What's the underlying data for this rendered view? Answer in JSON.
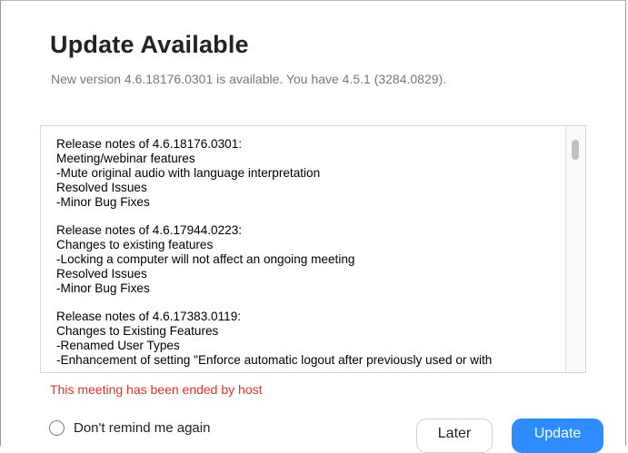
{
  "dialog": {
    "title": "Update Available",
    "subtitle": "New version 4.6.18176.0301 is available. You have 4.5.1 (3284.0829)."
  },
  "release_notes": {
    "blocks": [
      {
        "lines": [
          "Release notes of 4.6.18176.0301:",
          "Meeting/webinar features",
          "-Mute original audio with language interpretation",
          "Resolved Issues",
          "-Minor Bug Fixes"
        ]
      },
      {
        "lines": [
          "Release notes of 4.6.17944.0223:",
          "Changes to existing features",
          "-Locking a computer will not affect an ongoing meeting",
          "Resolved Issues",
          "-Minor Bug Fixes"
        ]
      },
      {
        "lines": [
          "Release notes of 4.6.17383.0119:",
          "Changes to Existing Features",
          "-Renamed User Types",
          "-Enhancement of setting \"Enforce automatic logout after previously used or with"
        ]
      }
    ]
  },
  "status": {
    "error_message": "This meeting has been ended by host",
    "error_color": "#e0332e"
  },
  "footer": {
    "remind_label": "Don't remind me again",
    "remind_checked": false,
    "later_label": "Later",
    "update_label": "Update",
    "accent_color": "#2d8cff"
  }
}
